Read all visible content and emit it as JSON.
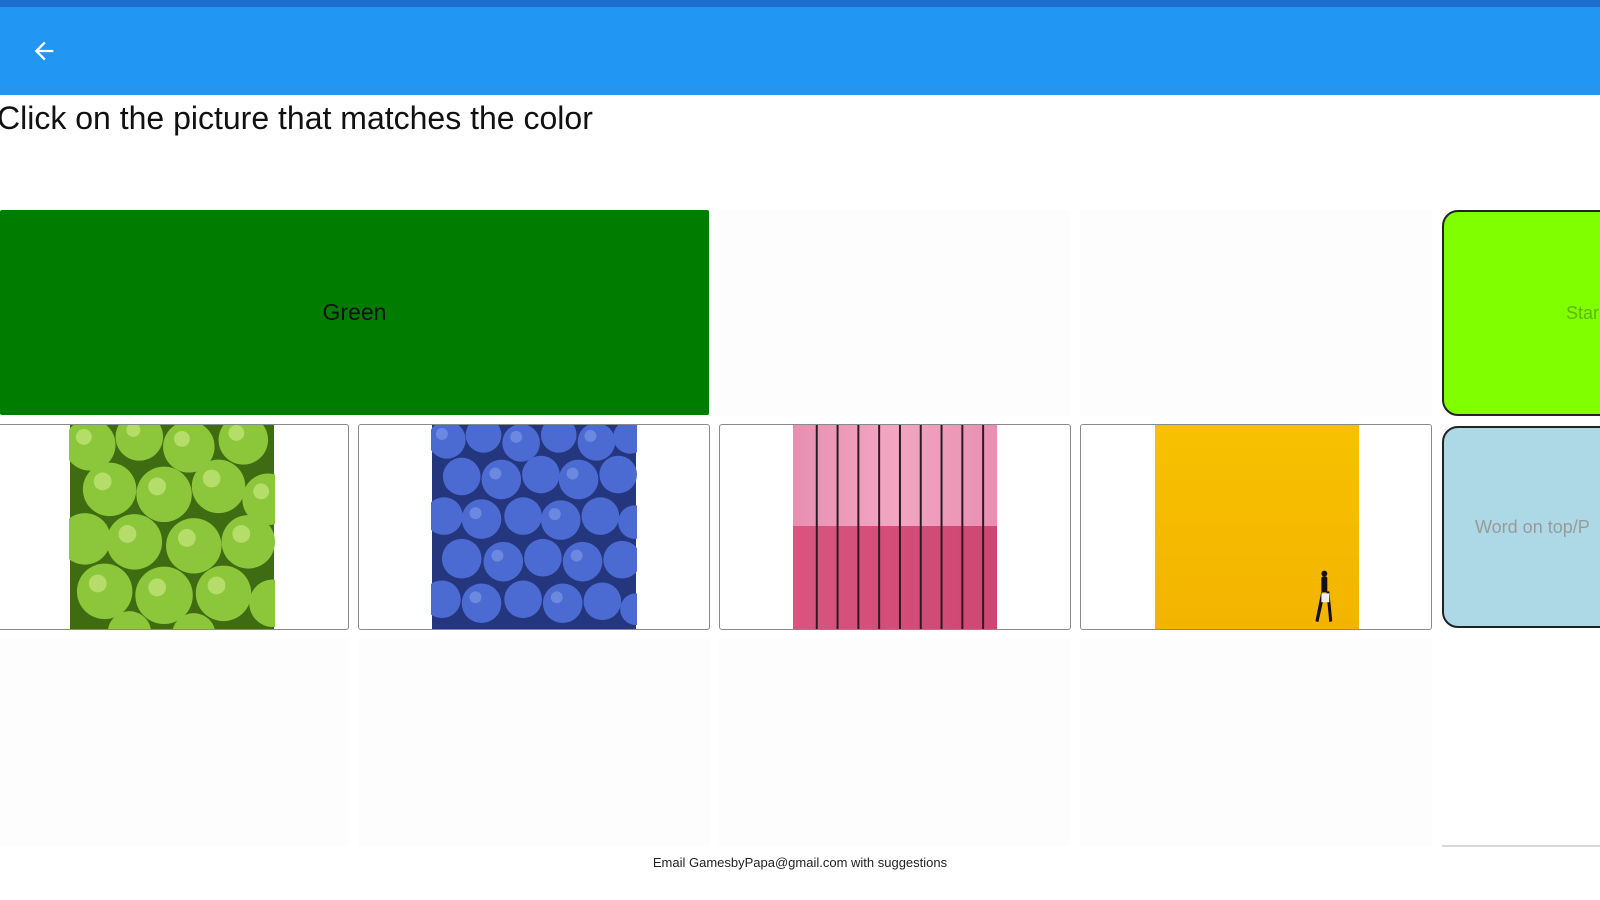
{
  "header": {
    "back_icon": "arrow-left-icon"
  },
  "instruction": "Click on the picture that matches the color",
  "target_color": {
    "label": "Green",
    "swatch": "#007c00"
  },
  "pictures": [
    {
      "name": "green apples",
      "icon": "green-apples-photo"
    },
    {
      "name": "blueberries",
      "icon": "blueberries-photo"
    },
    {
      "name": "pink wall",
      "icon": "pink-striped-wall-photo"
    },
    {
      "name": "yellow wall",
      "icon": "yellow-wall-with-walker-photo"
    }
  ],
  "side_buttons": {
    "start_label": "Star",
    "word_label": "Word on top/P"
  },
  "footer": "Email GamesbyPapa@gmail.com with suggestions",
  "colors": {
    "app_bar": "#2196f3",
    "start": "#7fff00",
    "word": "#add8e6"
  }
}
